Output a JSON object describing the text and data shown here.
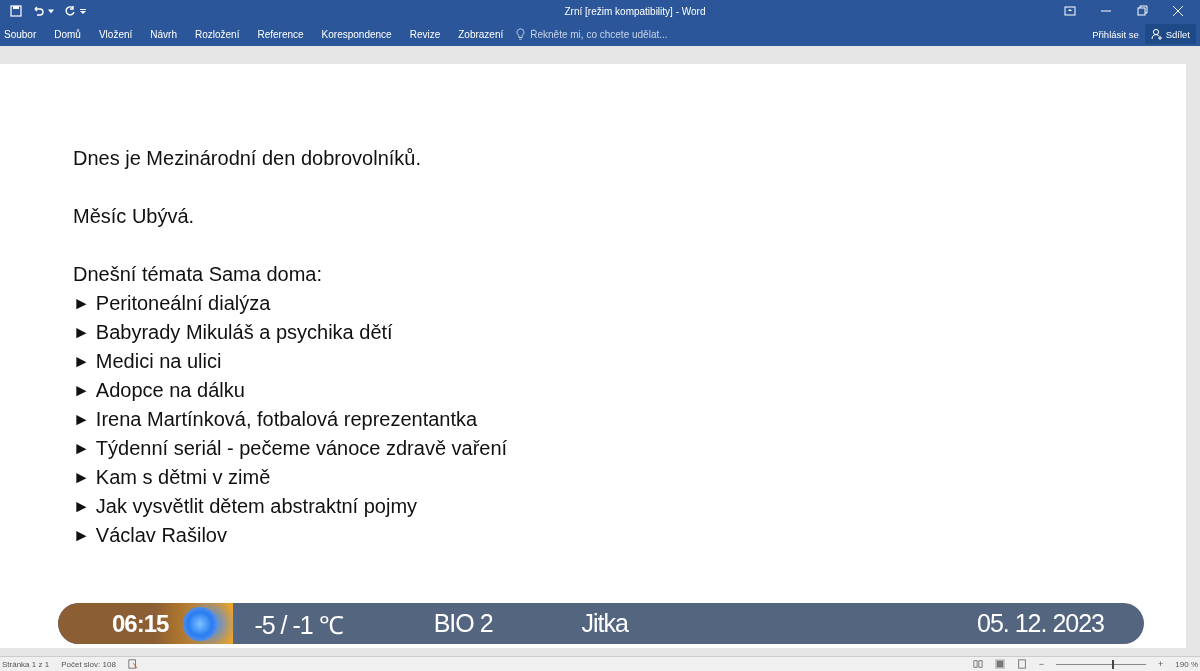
{
  "window": {
    "title": "Zrní [režim kompatibility] - Word"
  },
  "ribbon_tabs": [
    {
      "label": "Soubor",
      "selected": false
    },
    {
      "label": "Domů",
      "selected": false
    },
    {
      "label": "Vložení",
      "selected": false
    },
    {
      "label": "Návrh",
      "selected": false
    },
    {
      "label": "Rozložení",
      "selected": false
    },
    {
      "label": "Reference",
      "selected": false
    },
    {
      "label": "Korespondence",
      "selected": false
    },
    {
      "label": "Revize",
      "selected": false
    },
    {
      "label": "Zobrazení",
      "selected": false
    }
  ],
  "tell_me": {
    "placeholder": "Řekněte mi, co chcete udělat..."
  },
  "sign_in": "Přihlásit se",
  "share": "Sdílet",
  "document": {
    "paragraphs": [
      {
        "kind": "line",
        "text": "Dnes je Mezinárodní den dobrovolníků."
      },
      {
        "kind": "blank"
      },
      {
        "kind": "line",
        "text": "Měsíc Ubývá."
      },
      {
        "kind": "blank"
      },
      {
        "kind": "line",
        "text": "Dnešní témata Sama doma:"
      },
      {
        "kind": "bullet",
        "marker": "►",
        "text": "Peritoneální dialýza"
      },
      {
        "kind": "bullet",
        "marker": "►",
        "text": "Babyrady Mikuláš a psychika dětí"
      },
      {
        "kind": "bullet",
        "marker": "►",
        "text": "Medici na ulici"
      },
      {
        "kind": "bullet",
        "marker": "►",
        "text": "Adopce na dálku"
      },
      {
        "kind": "bullet",
        "marker": "►",
        "text": "Irena Martínková, fotbalová reprezentantka"
      },
      {
        "kind": "bullet",
        "marker": "►",
        "text": "Týdenní seriál - pečeme vánoce zdravě vaření"
      },
      {
        "kind": "bullet",
        "marker": "►",
        "text": "Kam s dětmi v zimě"
      },
      {
        "kind": "bullet",
        "marker": "►",
        "text": "Jak vysvětlit dětem abstraktní pojmy"
      },
      {
        "kind": "bullet",
        "marker": "►",
        "text": "Václav Rašilov"
      }
    ]
  },
  "ticker": {
    "time": "06:15",
    "temperature": "-5 / -1 ℃",
    "channel": "BIO 2",
    "name": "Jitka",
    "date": "05. 12. 2023"
  },
  "status_bar": {
    "page": "Stránka 1 z 1",
    "words": "Počet slov: 108",
    "zoom_out": "−",
    "zoom_in": "+",
    "zoom": "190 %",
    "zoom_slider": {
      "level": 0.62
    }
  }
}
